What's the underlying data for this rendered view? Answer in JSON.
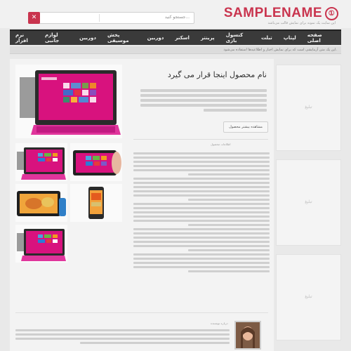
{
  "header": {
    "logo_text": "SAMPLENAME",
    "logo_mark": "①",
    "tagline": "این سایت یک نمونه برای نمایش قالب می‌باشد",
    "search_placeholder": "جستجو کنید...",
    "search_icon": "x-icon"
  },
  "nav": {
    "items": [
      "صفحه اصلی",
      "لپتاپ",
      "تبلت",
      "کنسول بازی",
      "پرینتر",
      "اسکنر",
      "دوربین",
      "پخش موسیقی",
      "دوربین",
      "لوازم جانبی",
      "نرم افزار"
    ]
  },
  "ticker": {
    "text": "این یک متن آزمایشی است که برای نمایش اخبار و اطلاعیه‌ها استفاده می‌شود."
  },
  "article": {
    "title": "نام محصول اینجا قرار می گیرد",
    "more_button": "مشاهده بیشتر محصول",
    "info_label": "اطلاعات محصول",
    "author_label": "درباره نویسنده"
  },
  "sidebar": {
    "ads": [
      "تبلیغ",
      "تبلیغ",
      "تبلیغ"
    ]
  },
  "colors": {
    "accent": "#c9344e",
    "nav_bg": "#3a3a3a"
  }
}
